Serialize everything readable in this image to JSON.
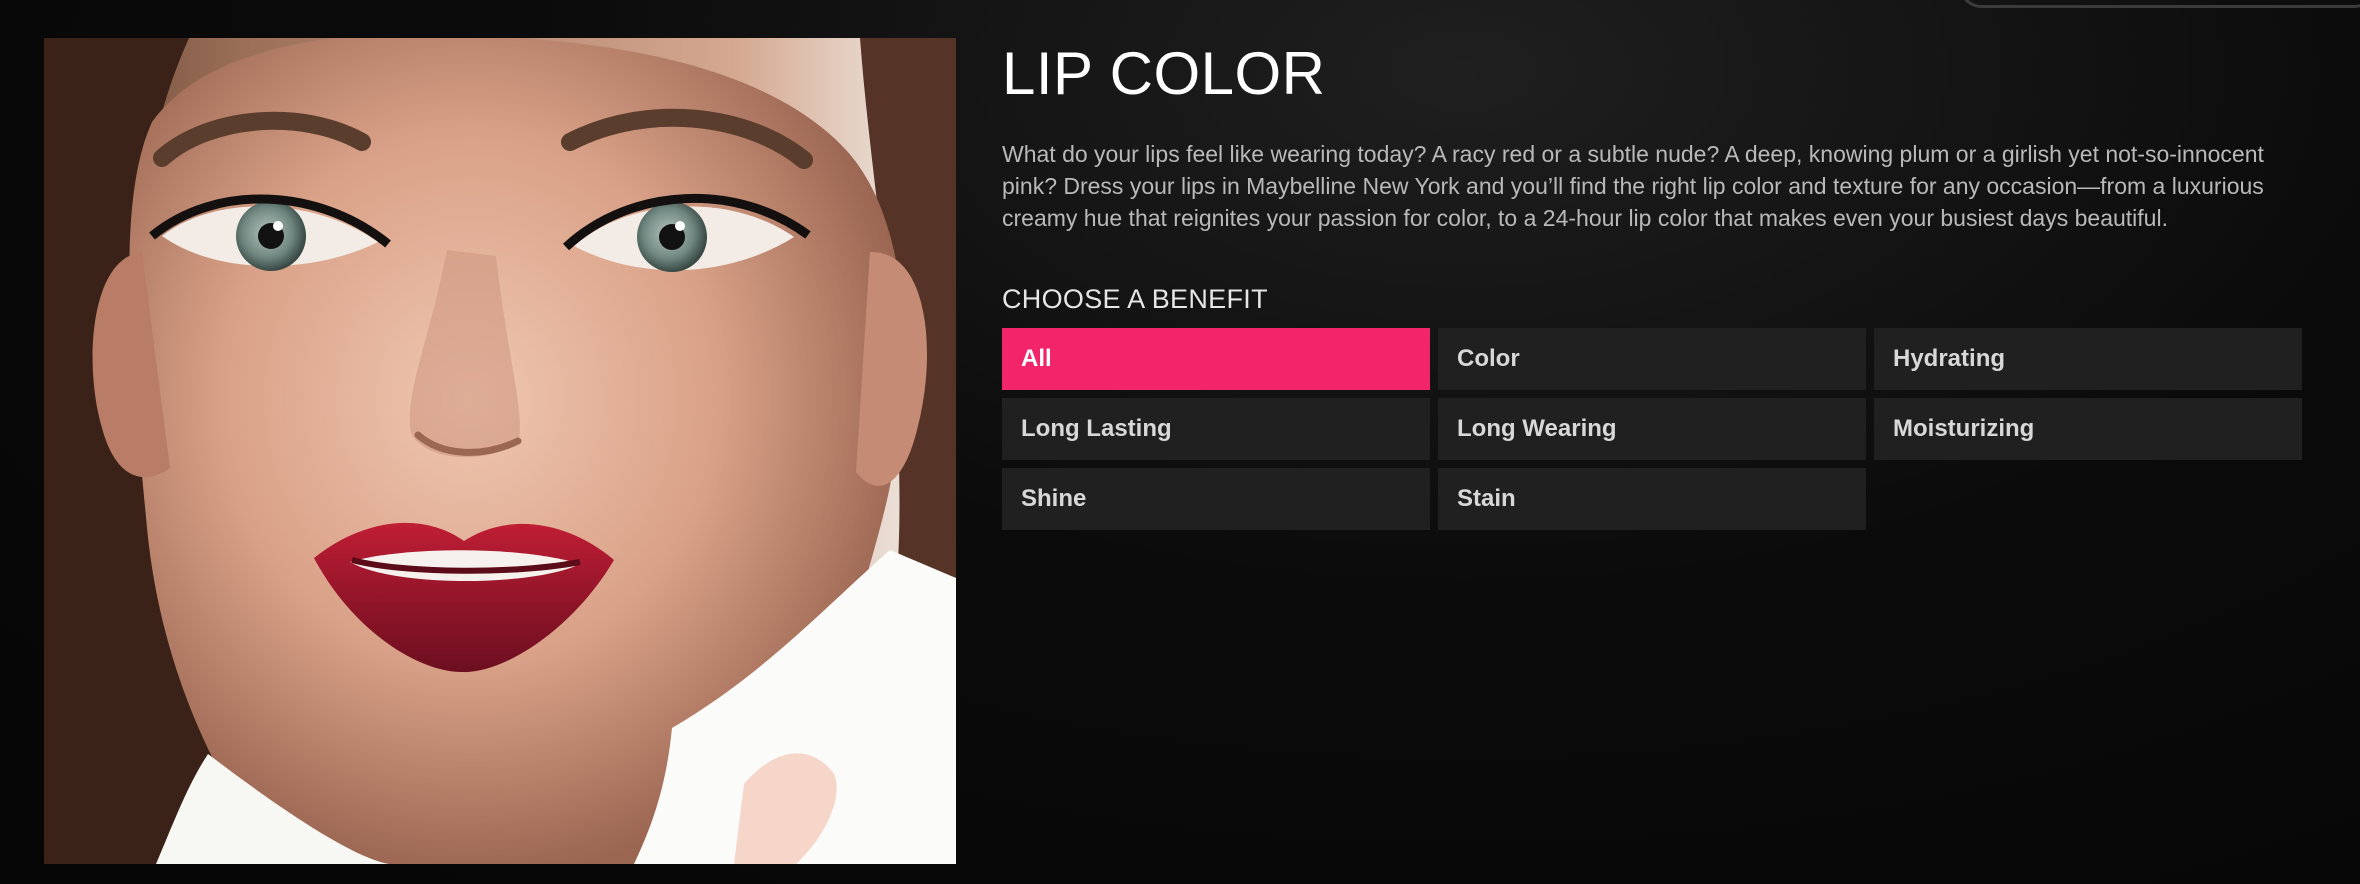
{
  "page": {
    "title": "LIP COLOR",
    "description": "What do your lips feel like wearing today? A racy red or a subtle nude? A deep, knowing plum or a girlish yet not-so-innocent pink? Dress your lips in Maybelline New York and you’ll find the right lip color and texture for any occasion—from a luxurious creamy hue that reignites your passion for color, to a 24-hour lip color that makes even your busiest days beautiful."
  },
  "benefits": {
    "heading": "CHOOSE A BENEFIT",
    "selected": "All",
    "options": [
      {
        "label": "All",
        "active": true
      },
      {
        "label": "Color",
        "active": false
      },
      {
        "label": "Hydrating",
        "active": false
      },
      {
        "label": "Long Lasting",
        "active": false
      },
      {
        "label": "Long Wearing",
        "active": false
      },
      {
        "label": "Moisturizing",
        "active": false
      },
      {
        "label": "Shine",
        "active": false
      },
      {
        "label": "Stain",
        "active": false
      }
    ]
  },
  "colors": {
    "background": "#060606",
    "accent": "#f2246a",
    "button": "#202020",
    "text": "#b9b9b9",
    "lip": "#a31c2e"
  }
}
